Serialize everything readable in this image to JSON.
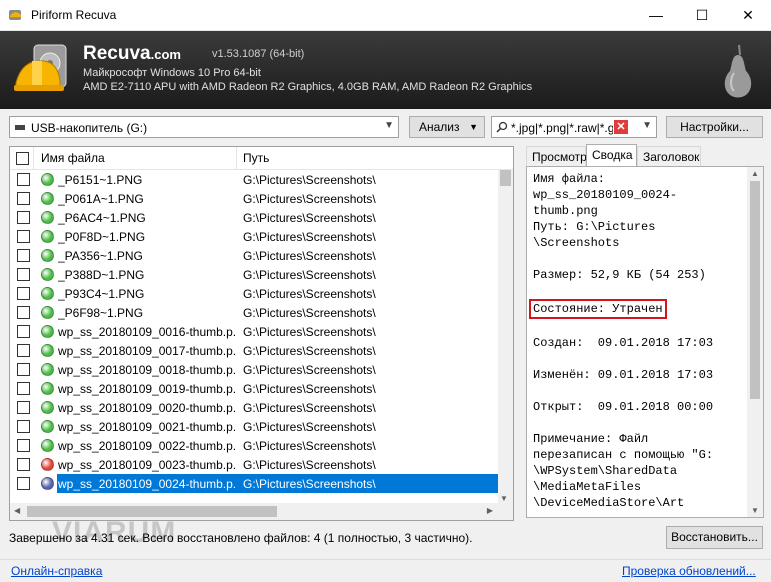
{
  "window": {
    "title": "Piriform Recuva",
    "minimize": "—",
    "maximize": "☐",
    "close": "✕"
  },
  "header": {
    "brand": "Recuva",
    "brand_suffix": ".com",
    "version": "v1.53.1087 (64-bit)",
    "os": "Майкрософт Windows 10 Pro 64-bit",
    "hardware": "AMD E2-7110 APU with AMD Radeon R2 Graphics, 4.0GB RAM, AMD Radeon R2 Graphics"
  },
  "toolbar": {
    "drive": "USB-накопитель (G:)",
    "scan_label": "Анализ",
    "filter_value": "*.jpg|*.png|*.raw|*.gif",
    "settings_label": "Настройки..."
  },
  "list": {
    "columns": {
      "name": "Имя файла",
      "path": "Путь"
    },
    "rows": [
      {
        "name": "_P6151~1.PNG",
        "path": "G:\\Pictures\\Screenshots\\",
        "state": "green"
      },
      {
        "name": "_P061A~1.PNG",
        "path": "G:\\Pictures\\Screenshots\\",
        "state": "green"
      },
      {
        "name": "_P6AC4~1.PNG",
        "path": "G:\\Pictures\\Screenshots\\",
        "state": "green"
      },
      {
        "name": "_P0F8D~1.PNG",
        "path": "G:\\Pictures\\Screenshots\\",
        "state": "green"
      },
      {
        "name": "_PA356~1.PNG",
        "path": "G:\\Pictures\\Screenshots\\",
        "state": "green"
      },
      {
        "name": "_P388D~1.PNG",
        "path": "G:\\Pictures\\Screenshots\\",
        "state": "green"
      },
      {
        "name": "_P93C4~1.PNG",
        "path": "G:\\Pictures\\Screenshots\\",
        "state": "green"
      },
      {
        "name": "_P6F98~1.PNG",
        "path": "G:\\Pictures\\Screenshots\\",
        "state": "green"
      },
      {
        "name": "wp_ss_20180109_0016-thumb.p...",
        "path": "G:\\Pictures\\Screenshots\\",
        "state": "green"
      },
      {
        "name": "wp_ss_20180109_0017-thumb.p...",
        "path": "G:\\Pictures\\Screenshots\\",
        "state": "green"
      },
      {
        "name": "wp_ss_20180109_0018-thumb.p...",
        "path": "G:\\Pictures\\Screenshots\\",
        "state": "green"
      },
      {
        "name": "wp_ss_20180109_0019-thumb.p...",
        "path": "G:\\Pictures\\Screenshots\\",
        "state": "green"
      },
      {
        "name": "wp_ss_20180109_0020-thumb.p...",
        "path": "G:\\Pictures\\Screenshots\\",
        "state": "green"
      },
      {
        "name": "wp_ss_20180109_0021-thumb.p...",
        "path": "G:\\Pictures\\Screenshots\\",
        "state": "green"
      },
      {
        "name": "wp_ss_20180109_0022-thumb.p...",
        "path": "G:\\Pictures\\Screenshots\\",
        "state": "green"
      },
      {
        "name": "wp_ss_20180109_0023-thumb.p...",
        "path": "G:\\Pictures\\Screenshots\\",
        "state": "red"
      },
      {
        "name": "wp_ss_20180109_0024-thumb.p...",
        "path": "G:\\Pictures\\Screenshots\\",
        "state": "gray",
        "selected": true
      }
    ]
  },
  "tabs": [
    "Просмотр",
    "Сводка",
    "Заголовок"
  ],
  "info": {
    "lines": [
      "Имя файла:",
      "wp_ss_20180109_0024-",
      "thumb.png",
      "Путь: G:\\Pictures",
      "\\Screenshots",
      "",
      "Размер: 52,9 КБ (54 253)",
      "",
      "Состояние: Утрачен",
      "",
      "Создан:  09.01.2018 17:03",
      "",
      "Изменён: 09.01.2018 17:03",
      "",
      "Открыт:  09.01.2018 00:00",
      "",
      "Примечание: Файл",
      "перезаписан с помощью \"G:",
      "\\WPSystem\\SharedData",
      "\\MediaMetaFiles",
      "\\DeviceMediaStore\\Art"
    ],
    "highlight_index": 8
  },
  "status": "Завершено за 4.31 сек. Всего восстановлено файлов: 4 (1 полностью, 3 частично).",
  "recover_label": "Восстановить...",
  "footer": {
    "help": "Онлайн-справка",
    "updates": "Проверка обновлений..."
  },
  "watermark": "VIARUM",
  "colors": {
    "green": "#4cbb47",
    "red": "#e0463a",
    "gray": "#5a63a8",
    "selection": "#0078d7",
    "highlight_border": "#d6141c"
  }
}
